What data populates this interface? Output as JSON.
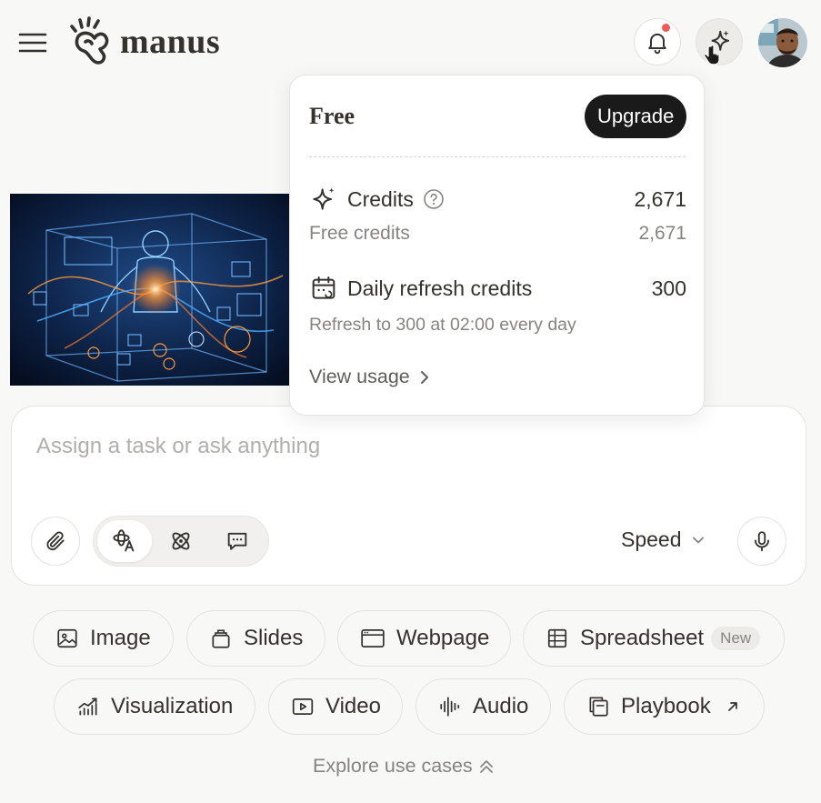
{
  "header": {
    "brand": "manus",
    "icons": {
      "menu": "hamburger-menu-icon",
      "notifications": "bell-icon",
      "credits": "sparkle-icon"
    },
    "has_notification": true
  },
  "credits_popover": {
    "plan": "Free",
    "upgrade_label": "Upgrade",
    "credits_label": "Credits",
    "credits_value": "2,671",
    "free_credits_label": "Free credits",
    "free_credits_value": "2,671",
    "daily_label": "Daily refresh credits",
    "daily_value": "300",
    "refresh_note": "Refresh to 300 at 02:00 every day",
    "view_usage_label": "View usage"
  },
  "composer": {
    "placeholder": "Assign a task or ask anything",
    "value": "",
    "mode_selected": "speed",
    "speed_label": "Speed"
  },
  "quick_actions": {
    "row1": [
      {
        "label": "Image",
        "icon": "image-icon"
      },
      {
        "label": "Slides",
        "icon": "slides-icon"
      },
      {
        "label": "Webpage",
        "icon": "webpage-icon"
      },
      {
        "label": "Spreadsheet",
        "icon": "table-icon",
        "badge": "New"
      }
    ],
    "row2": [
      {
        "label": "Visualization",
        "icon": "chart-icon"
      },
      {
        "label": "Video",
        "icon": "video-icon"
      },
      {
        "label": "Audio",
        "icon": "audio-wave-icon"
      },
      {
        "label": "Playbook",
        "icon": "playbook-icon"
      }
    ]
  },
  "explore_label": "Explore use cases",
  "colors": {
    "background": "#f8f8f7",
    "text": "#34322d",
    "muted": "#858481",
    "dark_button": "#1a1a1a",
    "notification_dot": "#f25757"
  }
}
